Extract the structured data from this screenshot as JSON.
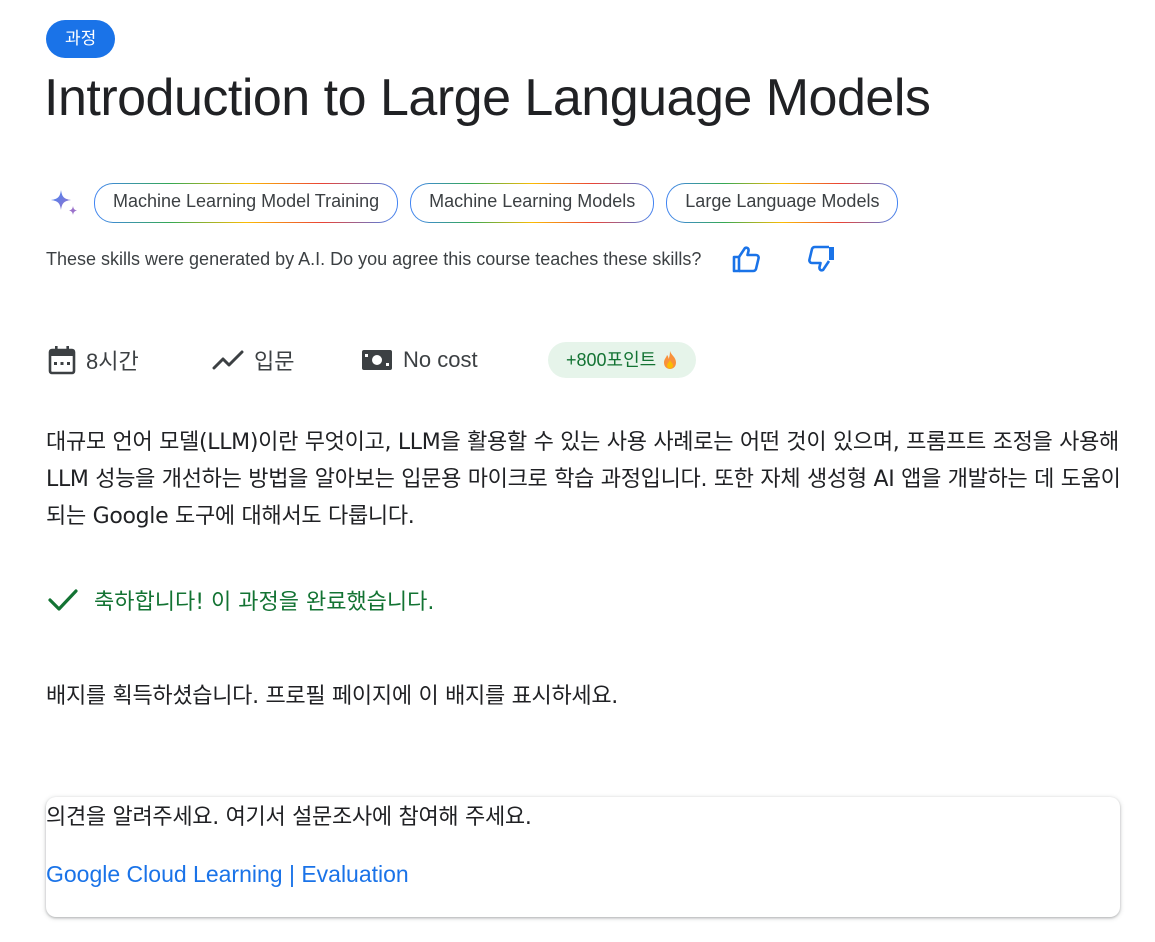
{
  "course": {
    "type_label": "과정",
    "title": "Introduction to Large Language Models"
  },
  "skills": {
    "icon": "sparkle-icon",
    "chips": [
      "Machine Learning Model Training",
      "Machine Learning Models",
      "Large Language Models"
    ],
    "ai_note": "These skills were generated by A.I. Do you agree this course teaches these skills?",
    "thumbs_up_icon": "thumbs-up-icon",
    "thumbs_down_icon": "thumbs-down-icon"
  },
  "meta": {
    "duration": "8시간",
    "level": "입문",
    "cost": "No cost",
    "points": "+800포인트"
  },
  "description": "대규모 언어 모델(LLM)이란 무엇이고, LLM을 활용할 수 있는 사용 사례로는 어떤 것이 있으며, 프롬프트 조정을 사용해 LLM 성능을 개선하는 방법을 알아보는 입문용 마이크로 학습 과정입니다. 또한 자체 생성형 AI 앱을 개발하는 데 도움이 되는 Google 도구에 대해서도 다룹니다.",
  "completion_message": "축하합니다! 이 과정을 완료했습니다.",
  "badge_message": "배지를 획득하셨습니다. 프로필 페이지에 이 배지를 표시하세요.",
  "feedback": {
    "prompt": "의견을 알려주세요. 여기서 설문조사에 참여해 주세요.",
    "link_text": "Google Cloud Learning | Evaluation"
  },
  "colors": {
    "accent_blue": "#1a73e8",
    "success_green": "#137333",
    "points_bg": "#e6f4ea"
  }
}
